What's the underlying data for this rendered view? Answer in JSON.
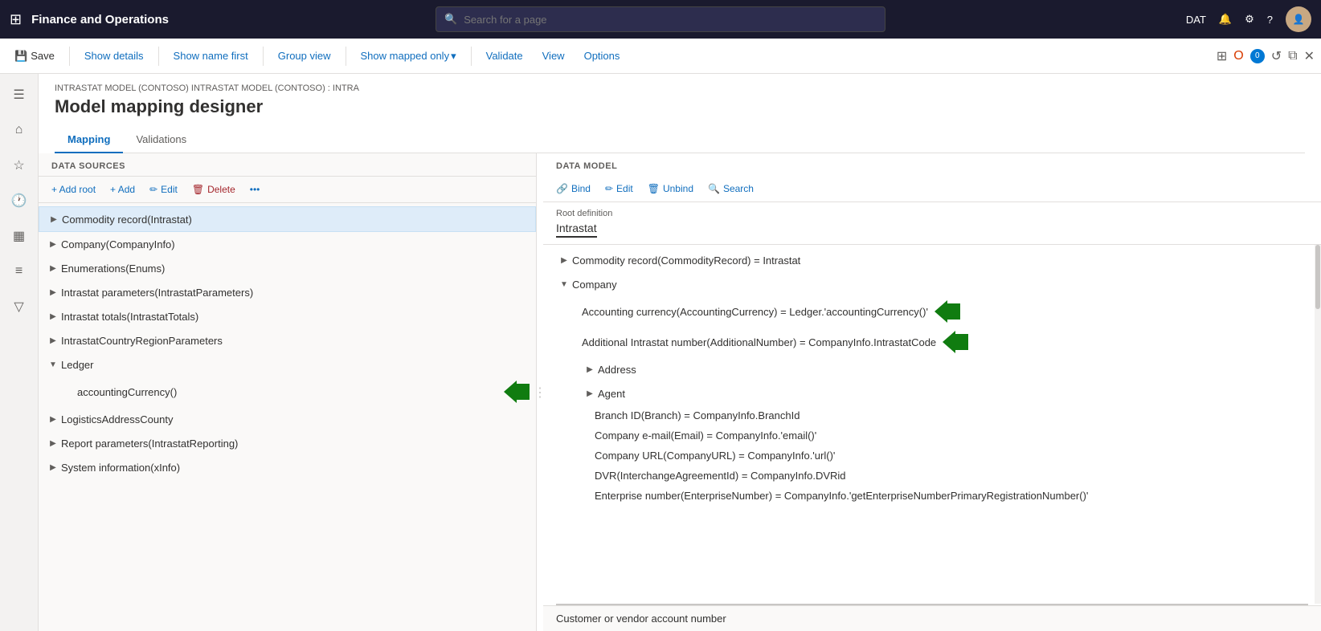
{
  "app": {
    "title": "Finance and Operations",
    "search_placeholder": "Search for a page",
    "env": "DAT"
  },
  "command_bar": {
    "save": "Save",
    "show_details": "Show details",
    "show_name_first": "Show name first",
    "group_view": "Group view",
    "show_mapped_only": "Show mapped only",
    "validate": "Validate",
    "view": "View",
    "options": "Options"
  },
  "page": {
    "breadcrumb": "INTRASTAT MODEL (CONTOSO) INTRASTAT MODEL (CONTOSO) : INTRA",
    "title": "Model mapping designer",
    "tabs": [
      "Mapping",
      "Validations"
    ]
  },
  "left_panel": {
    "title": "DATA SOURCES",
    "add_root": "+ Add root",
    "add": "+ Add",
    "edit": "Edit",
    "delete": "Delete",
    "items": [
      {
        "label": "Commodity record(Intrastat)",
        "indent": 1,
        "expanded": false,
        "selected": true
      },
      {
        "label": "Company(CompanyInfo)",
        "indent": 1,
        "expanded": false
      },
      {
        "label": "Enumerations(Enums)",
        "indent": 1,
        "expanded": false
      },
      {
        "label": "Intrastat parameters(IntrastatParameters)",
        "indent": 1,
        "expanded": false
      },
      {
        "label": "Intrastat totals(IntrastatTotals)",
        "indent": 1,
        "expanded": false
      },
      {
        "label": "IntrastatCountryRegionParameters",
        "indent": 1,
        "expanded": false
      },
      {
        "label": "Ledger",
        "indent": 1,
        "expanded": true,
        "is_parent": true
      },
      {
        "label": "accountingCurrency()",
        "indent": 2,
        "has_arrow": true
      },
      {
        "label": "LogisticsAddressCounty",
        "indent": 1,
        "expanded": false
      },
      {
        "label": "Report parameters(IntrastatReporting)",
        "indent": 1,
        "expanded": false
      },
      {
        "label": "System information(xInfo)",
        "indent": 1,
        "expanded": false
      }
    ]
  },
  "right_panel": {
    "title": "DATA MODEL",
    "bind": "Bind",
    "edit": "Edit",
    "unbind": "Unbind",
    "search": "Search",
    "root_def_label": "Root definition",
    "root_def_value": "Intrastat",
    "items": [
      {
        "label": "Commodity record(CommodityRecord) = Intrastat",
        "indent": 1,
        "expanded": false
      },
      {
        "label": "Company",
        "indent": 1,
        "expanded": true,
        "is_parent": true
      },
      {
        "label": "Accounting currency(AccountingCurrency) = Ledger.'accountingCurrency()'",
        "indent": 2,
        "has_arrow": true
      },
      {
        "label": "Additional Intrastat number(AdditionalNumber) = CompanyInfo.IntrastatCode",
        "indent": 2,
        "has_arrow": true
      },
      {
        "label": "Address",
        "indent": 2,
        "expanded": false
      },
      {
        "label": "Agent",
        "indent": 2,
        "expanded": false
      },
      {
        "label": "Branch ID(Branch) = CompanyInfo.BranchId",
        "indent": 3
      },
      {
        "label": "Company e-mail(Email) = CompanyInfo.'email()'",
        "indent": 3
      },
      {
        "label": "Company URL(CompanyURL) = CompanyInfo.'url()'",
        "indent": 3
      },
      {
        "label": "DVR(InterchangeAgreementId) = CompanyInfo.DVRid",
        "indent": 3
      },
      {
        "label": "Enterprise number(EnterpriseNumber) = CompanyInfo.'getEnterpriseNumberPrimaryRegistrationNumber()'",
        "indent": 3
      }
    ],
    "bottom_text": "Customer or vendor account number"
  }
}
